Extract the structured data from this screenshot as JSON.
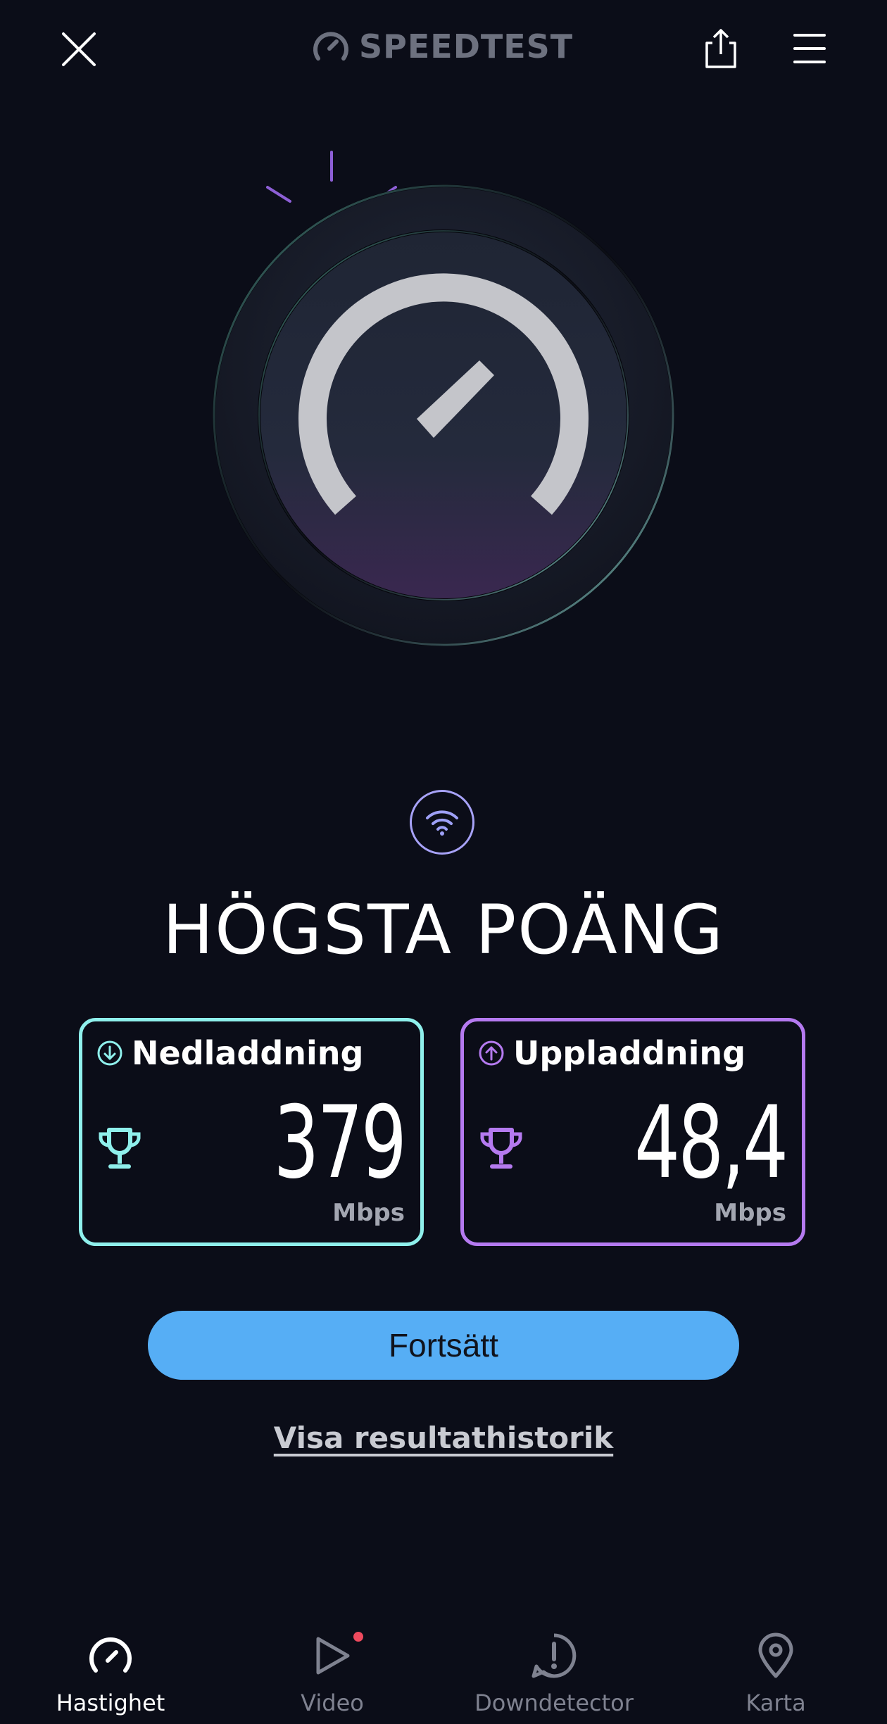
{
  "header": {
    "logo_text": "SPEEDTEST",
    "close_icon": "close-icon",
    "share_icon": "share-icon",
    "menu_icon": "hamburger-menu-icon"
  },
  "gauge": {
    "icon": "speedometer-icon"
  },
  "connection": {
    "icon": "wifi-icon"
  },
  "main": {
    "title": "HÖGSTA POÄNG",
    "download": {
      "label": "Nedladdning",
      "value": "379",
      "unit": "Mbps",
      "icon": "arrow-down-circle-icon",
      "badge_icon": "trophy-icon",
      "color": "#8ff0ec"
    },
    "upload": {
      "label": "Uppladdning",
      "value": "48,4",
      "unit": "Mbps",
      "icon": "arrow-up-circle-icon",
      "badge_icon": "trophy-icon",
      "color": "#b57af0"
    },
    "continue_label": "Fortsätt",
    "history_link": "Visa resultathistorik"
  },
  "nav": {
    "items": [
      {
        "label": "Hastighet",
        "icon": "speedometer-icon",
        "active": true
      },
      {
        "label": "Video",
        "icon": "play-icon",
        "active": false
      },
      {
        "label": "Downdetector",
        "icon": "alert-bubble-icon",
        "active": false
      },
      {
        "label": "Karta",
        "icon": "map-pin-icon",
        "active": false
      }
    ]
  },
  "colors": {
    "background": "#0b0d18",
    "accent_blue": "#56aef5",
    "download": "#8ff0ec",
    "upload": "#b57af0",
    "notification_dot": "#ef4a5e"
  }
}
